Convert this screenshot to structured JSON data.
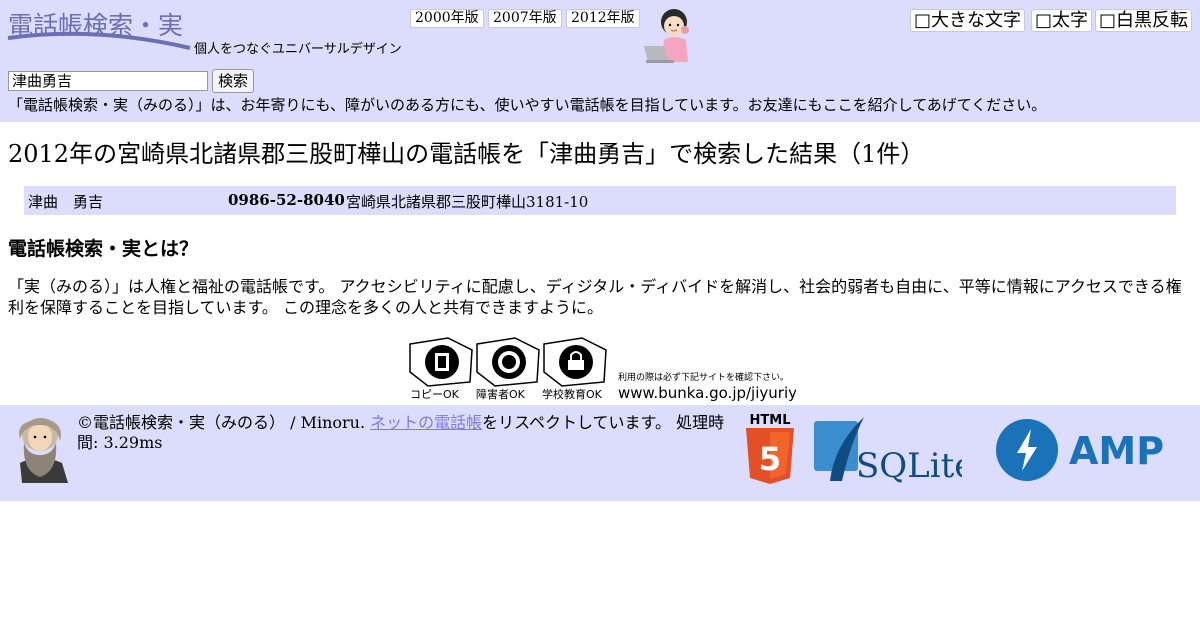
{
  "site": {
    "logo": "電話帳検索・実",
    "tagline": "個人をつなぐユニバーサルデザイン",
    "editions": [
      "2000年版",
      "2007年版",
      "2012年版"
    ],
    "options": [
      "□大きな文字",
      "□太字",
      "□白黒反転"
    ]
  },
  "search": {
    "value": "津曲勇吉",
    "button": "検索"
  },
  "intro": "「電話帳検索・実（みのる）」は、お年寄りにも、障がいのある方にも、使いやすい電話帳を目指しています。お友達にもここを紹介してあげてください。",
  "result": {
    "title": "2012年の宮崎県北諸県郡三股町樺山の電話帳を「津曲勇吉」で検索した結果（1件）",
    "rows": [
      {
        "name": "津曲　勇吉",
        "phone": "0986-52-8040",
        "address": "宮崎県北諸県郡三股町樺山3181-10"
      }
    ]
  },
  "about": {
    "heading": "電話帳検索・実とは？",
    "body": "「実（みのる）」は人権と福祉の電話帳です。 アクセシビリティに配慮し、ディジタル・ディバイドを解消し、社会的弱者も自由に、平等に情報にアクセスできる権利を保障することを目指しています。 この理念を多くの人と共有できますように。"
  },
  "jiyuriyo": {
    "labels": [
      "コピーOK",
      "障害者OK",
      "学校教育OK"
    ],
    "note": "利用の際は必ず下記サイトを確認下さい。",
    "url": "www.bunka.go.jp/jiyuriyo"
  },
  "footer": {
    "copyright": "©電話帳検索・実（みのる） / Minoru.",
    "link": "ネットの電話帳",
    "respect": "をリスペクトしています。",
    "time_label": "処理時間: 3.29ms"
  },
  "badges": {
    "html5": "HTML",
    "html5_num": "5",
    "sqlite": "SQLite",
    "amp": "AMP"
  },
  "colors": {
    "header_bg": "#dcdcfc",
    "logo": "#6b6fb3",
    "link": "#7b7be0"
  }
}
